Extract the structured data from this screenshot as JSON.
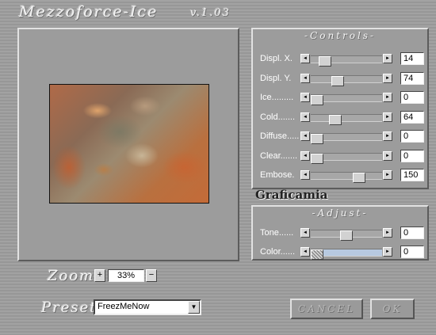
{
  "window": {
    "title": "Mezzoforce-Ice",
    "version": "v.1.03"
  },
  "controls": {
    "heading": "-Controls-",
    "sliders": [
      {
        "label": "Displ. X.",
        "value": "14",
        "level": 0.14
      },
      {
        "label": "Displ. Y.",
        "value": "74",
        "level": 0.35
      },
      {
        "label": "Ice.........",
        "value": "0",
        "level": 0.0
      },
      {
        "label": "Cold.......",
        "value": "64",
        "level": 0.31
      },
      {
        "label": "Diffuse.....",
        "value": "0",
        "level": 0.0
      },
      {
        "label": "Clear.......",
        "value": "0",
        "level": 0.0
      },
      {
        "label": "Embose.",
        "value": "150",
        "level": 0.72
      }
    ]
  },
  "watermark": "Graficamia",
  "adjust": {
    "heading": "-Adjust-",
    "sliders": [
      {
        "label": "Tone......",
        "value": "0",
        "level": 0.5
      },
      {
        "label": "Color......",
        "value": "0",
        "level": 0.0,
        "track_color": "#b7c9e0"
      }
    ]
  },
  "zoom": {
    "label": "Zoom",
    "value": "33%",
    "plus": "+",
    "minus": "−"
  },
  "preset": {
    "label": "Preset",
    "selected": "FreezMeNow"
  },
  "buttons": {
    "cancel": "CANCEL",
    "ok": "OK"
  },
  "icons": {
    "left_arrow": "left-arrow-icon",
    "right_arrow": "right-arrow-icon",
    "dropdown": "chevron-down-icon"
  }
}
